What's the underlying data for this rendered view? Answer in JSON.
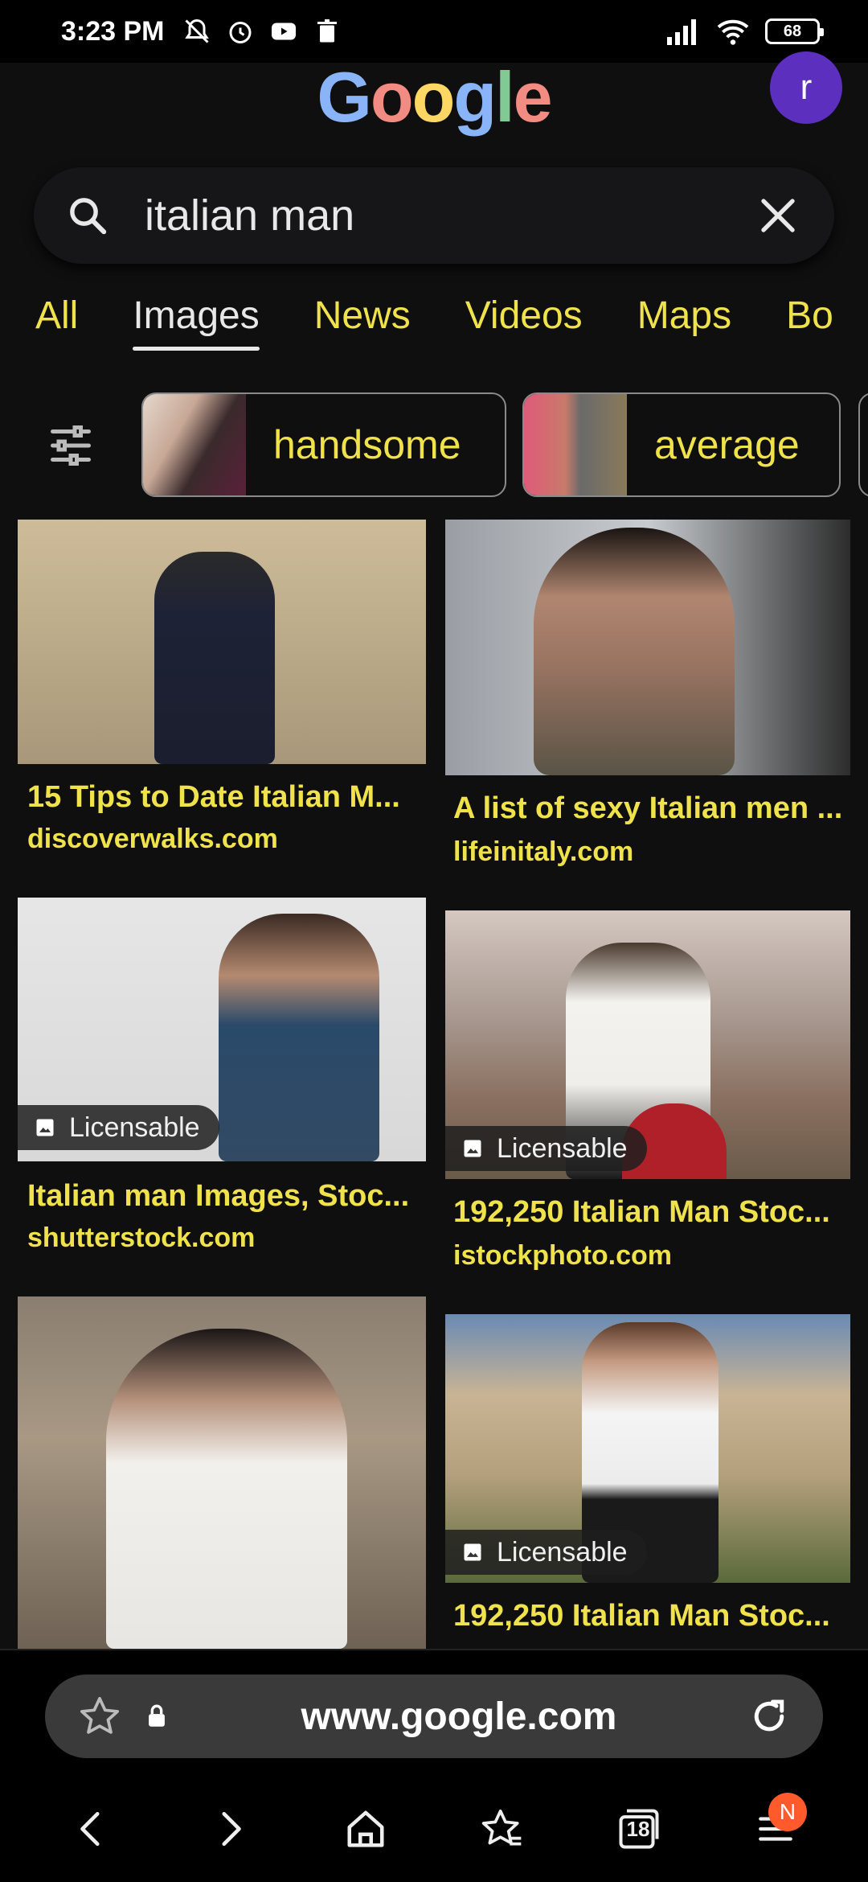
{
  "status_bar": {
    "time": "3:23 PM",
    "battery": "68"
  },
  "header": {
    "avatar_letter": "r"
  },
  "search": {
    "query": "italian man"
  },
  "tabs": [
    "All",
    "Images",
    "News",
    "Videos",
    "Maps",
    "Bo"
  ],
  "chips": [
    {
      "label": "handsome"
    },
    {
      "label": "average"
    }
  ],
  "results": [
    {
      "title": "15 Tips to Date Italian M...",
      "source": "discoverwalks.com",
      "licensable": false
    },
    {
      "title": "A list of sexy Italian men ...",
      "source": "lifeinitaly.com",
      "licensable": false
    },
    {
      "title": "Italian man Images, Stoc...",
      "source": "shutterstock.com",
      "licensable": true,
      "badge": "Licensable"
    },
    {
      "title": "192,250 Italian Man Stoc...",
      "source": "istockphoto.com",
      "licensable": true,
      "badge": "Licensable"
    },
    {
      "title": "",
      "source": "",
      "licensable": false
    },
    {
      "title": "192,250 Italian Man Stoc...",
      "source": "",
      "licensable": true,
      "badge": "Licensable"
    }
  ],
  "browser": {
    "url": "www.google.com",
    "tab_count": "18",
    "notification_letter": "N"
  },
  "colors": {
    "accent_yellow": "#f0e24a",
    "avatar_purple": "#5c2fbf",
    "background": "#0f0f10"
  },
  "icons": [
    "search-icon",
    "close-icon",
    "filter-icon",
    "lock-icon",
    "star-icon",
    "reload-icon",
    "back-icon",
    "forward-icon",
    "home-icon",
    "bookmarks-icon",
    "tabs-icon",
    "menu-icon",
    "image-icon"
  ]
}
